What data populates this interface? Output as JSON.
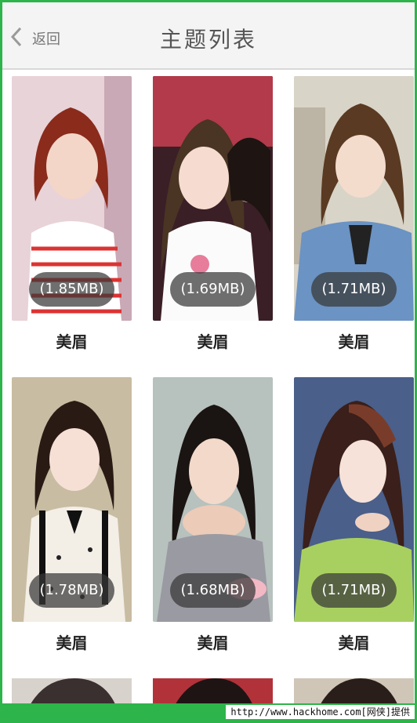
{
  "header": {
    "back_label": "返回",
    "title": "主题列表"
  },
  "themes": [
    {
      "name": "美眉",
      "size": "(1.85MB)"
    },
    {
      "name": "美眉",
      "size": "(1.69MB)"
    },
    {
      "name": "美眉",
      "size": "(1.71MB)"
    },
    {
      "name": "美眉",
      "size": "(1.78MB)"
    },
    {
      "name": "美眉",
      "size": "(1.68MB)"
    },
    {
      "name": "美眉",
      "size": "(1.71MB)"
    }
  ],
  "footer": {
    "watermark": "http://www.hackhome.com[网侠]提供"
  },
  "colors": {
    "accent": "#2db44a",
    "pill": "#373737"
  },
  "icons": {
    "back": "chevron-left-icon"
  }
}
